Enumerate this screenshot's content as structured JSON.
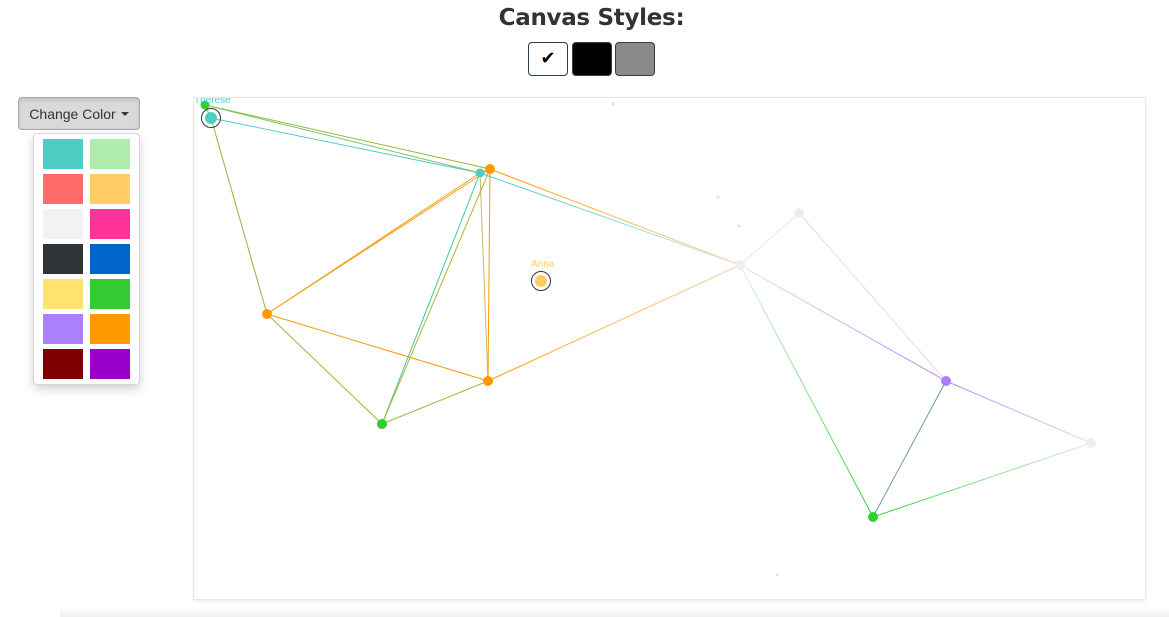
{
  "header": {
    "title": "Canvas Styles:"
  },
  "canvas_styles": [
    {
      "name": "white",
      "color": "#ffffff",
      "selected": true,
      "icon": "check-icon",
      "glyph": "✔"
    },
    {
      "name": "black",
      "color": "#000000",
      "selected": false
    },
    {
      "name": "gray",
      "color": "#8a8a8a",
      "selected": false
    }
  ],
  "color_dropdown": {
    "label": "Change Color",
    "icon": "caret-down-icon",
    "open": true,
    "colors": [
      "#4ecdc4",
      "#b0ecab",
      "#ff6b6b",
      "#ffcc66",
      "#f2f2f2",
      "#ff3399",
      "#2f3436",
      "#0066cc",
      "#ffe36e",
      "#33cc33",
      "#aa80ff",
      "#ff9900",
      "#800000",
      "#9900cc"
    ]
  },
  "graph": {
    "labels": {
      "therese": "Therese",
      "anna": "Anna"
    },
    "colors": {
      "teal": "#4ecdc4",
      "orange": "#ff9900",
      "green": "#33cc33",
      "purple": "#aa80ff",
      "light": "#eeeeee",
      "anna": "#ffcc66"
    }
  }
}
